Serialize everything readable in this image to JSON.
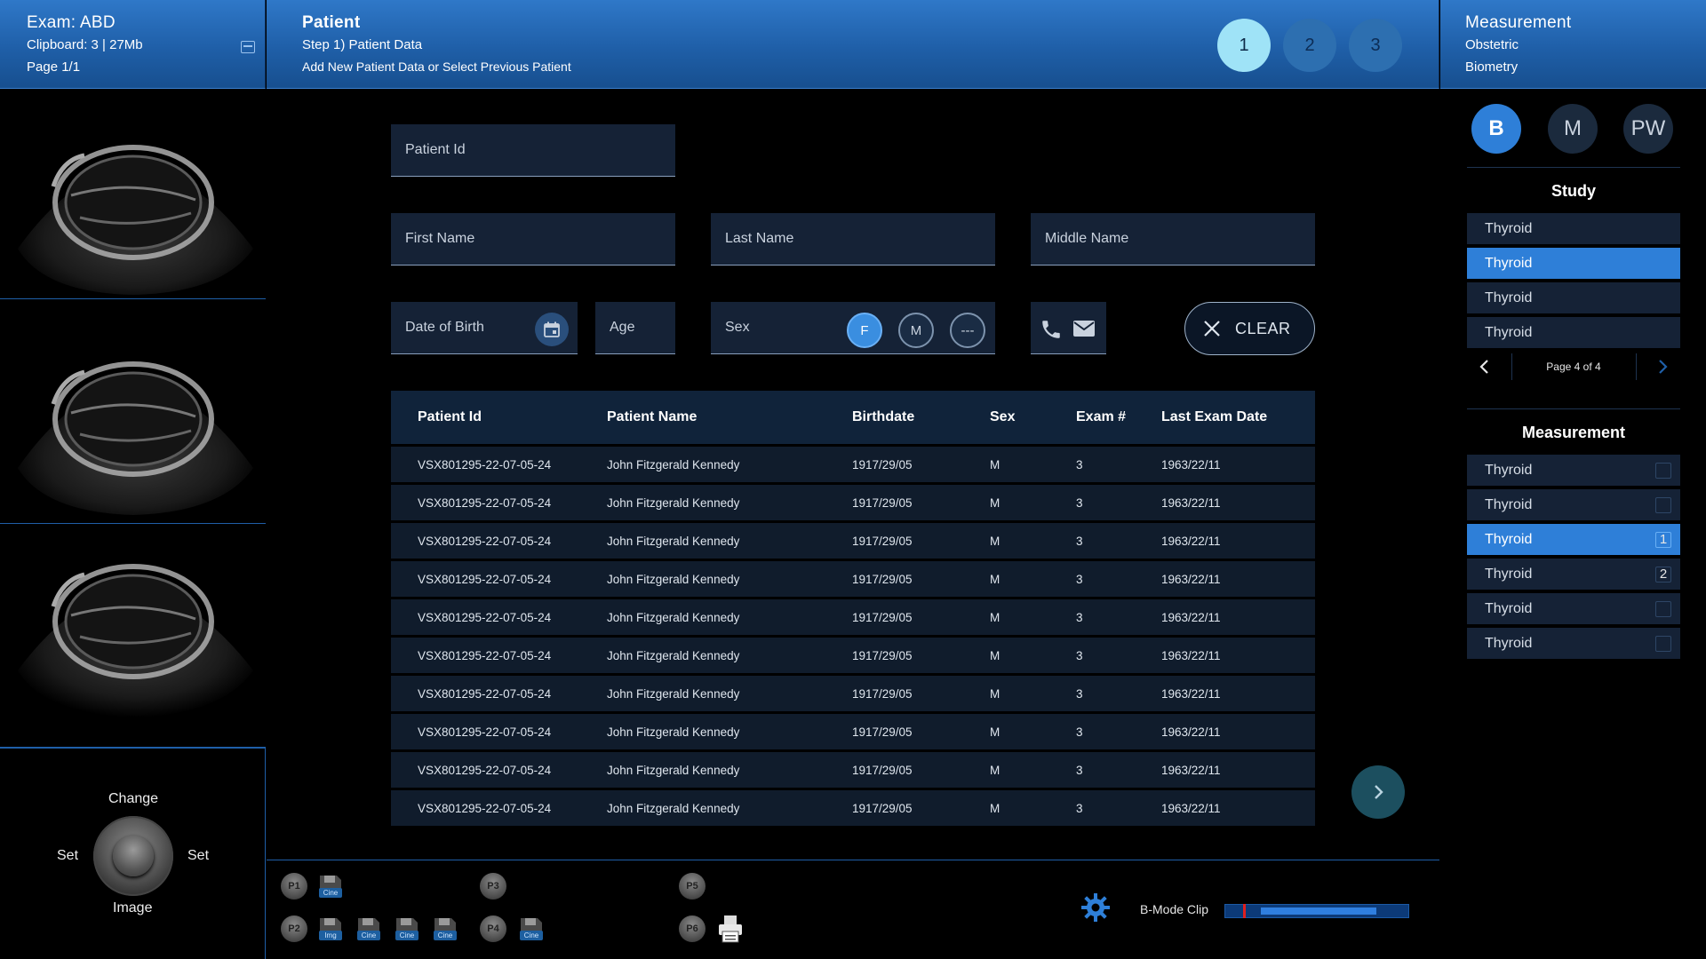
{
  "header": {
    "exam": "Exam: ABD",
    "clipboard": "Clipboard: 3 | 27Mb",
    "page": "Page 1/1",
    "title": "Patient",
    "step": "Step 1) Patient Data",
    "subtitle": "Add New Patient Data or Select Previous Patient",
    "steps": [
      "1",
      "2",
      "3"
    ],
    "active_step": "1",
    "right_title": "Measurement",
    "right_line1": "Obstetric",
    "right_line2": "Biometry"
  },
  "knob": {
    "top": "Change",
    "left": "Set",
    "right": "Set",
    "bottom": "Image"
  },
  "form": {
    "patient_id": "Patient Id",
    "first_name": "First Name",
    "last_name": "Last Name",
    "middle_name": "Middle Name",
    "dob": "Date of Birth",
    "age": "Age",
    "sex_label": "Sex",
    "sex_options": [
      "F",
      "M",
      "---"
    ],
    "sex_selected": "F",
    "clear": "CLEAR"
  },
  "table": {
    "headers": [
      "Patient Id",
      "Patient Name",
      "Birthdate",
      "Sex",
      "Exam #",
      "Last Exam Date"
    ],
    "rows": [
      [
        "VSX801295-22-07-05-24",
        "John Fitzgerald Kennedy",
        "1917/29/05",
        "M",
        "3",
        "1963/22/11"
      ],
      [
        "VSX801295-22-07-05-24",
        "John Fitzgerald Kennedy",
        "1917/29/05",
        "M",
        "3",
        "1963/22/11"
      ],
      [
        "VSX801295-22-07-05-24",
        "John Fitzgerald Kennedy",
        "1917/29/05",
        "M",
        "3",
        "1963/22/11"
      ],
      [
        "VSX801295-22-07-05-24",
        "John Fitzgerald Kennedy",
        "1917/29/05",
        "M",
        "3",
        "1963/22/11"
      ],
      [
        "VSX801295-22-07-05-24",
        "John Fitzgerald Kennedy",
        "1917/29/05",
        "M",
        "3",
        "1963/22/11"
      ],
      [
        "VSX801295-22-07-05-24",
        "John Fitzgerald Kennedy",
        "1917/29/05",
        "M",
        "3",
        "1963/22/11"
      ],
      [
        "VSX801295-22-07-05-24",
        "John Fitzgerald Kennedy",
        "1917/29/05",
        "M",
        "3",
        "1963/22/11"
      ],
      [
        "VSX801295-22-07-05-24",
        "John Fitzgerald Kennedy",
        "1917/29/05",
        "M",
        "3",
        "1963/22/11"
      ],
      [
        "VSX801295-22-07-05-24",
        "John Fitzgerald Kennedy",
        "1917/29/05",
        "M",
        "3",
        "1963/22/11"
      ],
      [
        "VSX801295-22-07-05-24",
        "John Fitzgerald Kennedy",
        "1917/29/05",
        "M",
        "3",
        "1963/22/11"
      ]
    ]
  },
  "bottom": {
    "presets": [
      "P1",
      "P2",
      "P3",
      "P4",
      "P5",
      "P6"
    ],
    "disk_labels": {
      "p1": [
        "Cine"
      ],
      "p2": [
        "Img",
        "Cine",
        "Cine",
        "Cine"
      ],
      "p4": [
        "Cine"
      ]
    },
    "bmode_label": "B-Mode Clip",
    "bmode_progress": 0.65
  },
  "right": {
    "modes": [
      "B",
      "M",
      "PW"
    ],
    "active_mode": "B",
    "study_title": "Study",
    "study_items": [
      "Thyroid",
      "Thyroid",
      "Thyroid",
      "Thyroid"
    ],
    "study_active_index": 1,
    "pager": "Page  4 of 4",
    "measurement_title": "Measurement",
    "measurement_items": [
      {
        "label": "Thyroid",
        "count": ""
      },
      {
        "label": "Thyroid",
        "count": ""
      },
      {
        "label": "Thyroid",
        "count": "1"
      },
      {
        "label": "Thyroid",
        "count": "2"
      },
      {
        "label": "Thyroid",
        "count": ""
      },
      {
        "label": "Thyroid",
        "count": ""
      }
    ],
    "measurement_active_index": 2
  },
  "colors": {
    "accent": "#2e7fd8",
    "header": "#1f5fa8",
    "panel": "#152236",
    "step_active": "#9fe3f7"
  },
  "icons": [
    "clipboard-icon",
    "calendar-icon",
    "phone-icon",
    "mail-icon",
    "close-icon",
    "chevron-right-icon",
    "chevron-left-icon",
    "gear-icon",
    "floppy-icon",
    "printer-icon"
  ]
}
